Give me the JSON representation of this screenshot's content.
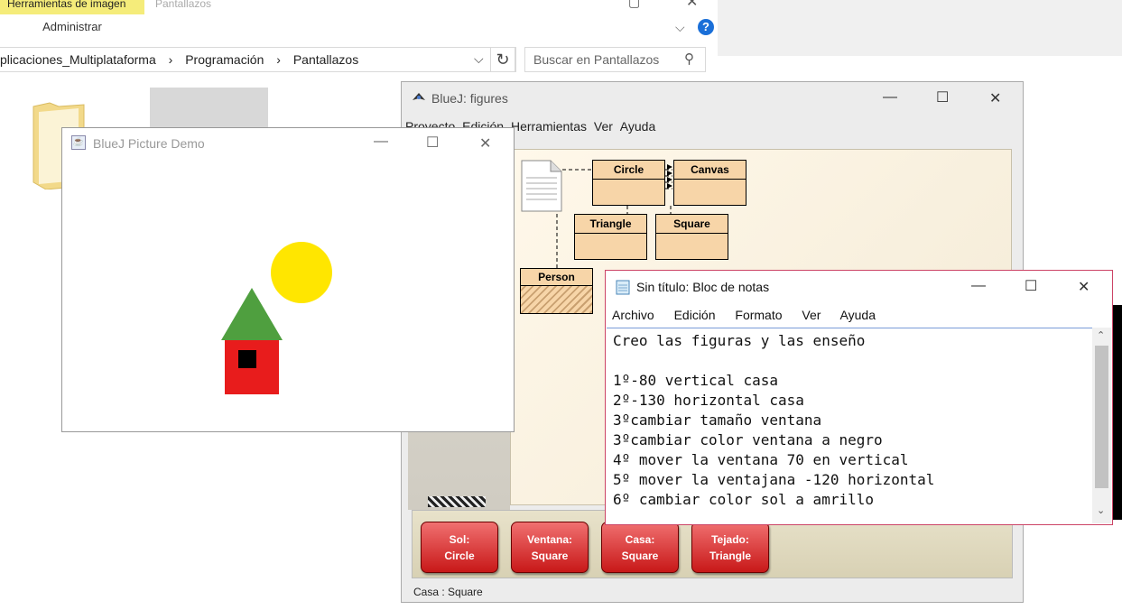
{
  "explorer": {
    "ribbon_tab": "Herramientas de imagen",
    "ribbon_tab2": "Pantallazos",
    "ribbon_context": "Administrar",
    "breadcrumb": [
      "plicaciones_Multiplataforma",
      "›",
      "Programación",
      "›",
      "Pantallazos"
    ],
    "search_placeholder": "Buscar en Pantallazos"
  },
  "bluej": {
    "title": "BlueJ:  figures",
    "menu": [
      "Proyecto",
      "Edición",
      "Herramientas",
      "Ver",
      "Ayuda"
    ],
    "classes": {
      "circle": "Circle",
      "canvas": "Canvas",
      "triangle": "Triangle",
      "square": "Square",
      "person": "Person"
    },
    "objects": [
      {
        "name": "Sol:",
        "type": "Circle"
      },
      {
        "name": "Ventana:",
        "type": "Square"
      },
      {
        "name": "Casa:",
        "type": "Square"
      },
      {
        "name": "Tejado:",
        "type": "Triangle"
      }
    ],
    "status": "Casa : Square"
  },
  "picture_demo": {
    "title": "BlueJ Picture Demo",
    "colors": {
      "sun": "#ffe600",
      "roof": "#4f9f3f",
      "house": "#e81c1c",
      "window": "#000000"
    }
  },
  "notepad": {
    "title": "Sin título: Bloc de notas",
    "menu": [
      "Archivo",
      "Edición",
      "Formato",
      "Ver",
      "Ayuda"
    ],
    "text": "Creo las figuras y las enseño\n\n1º-80 vertical casa\n2º-130 horizontal casa\n3ºcambiar tamaño ventana\n3ºcambiar color ventana a negro\n4º mover la ventana 70 en vertical\n5º mover la ventajana -120 horizontal\n6º cambiar color sol a amrillo"
  }
}
